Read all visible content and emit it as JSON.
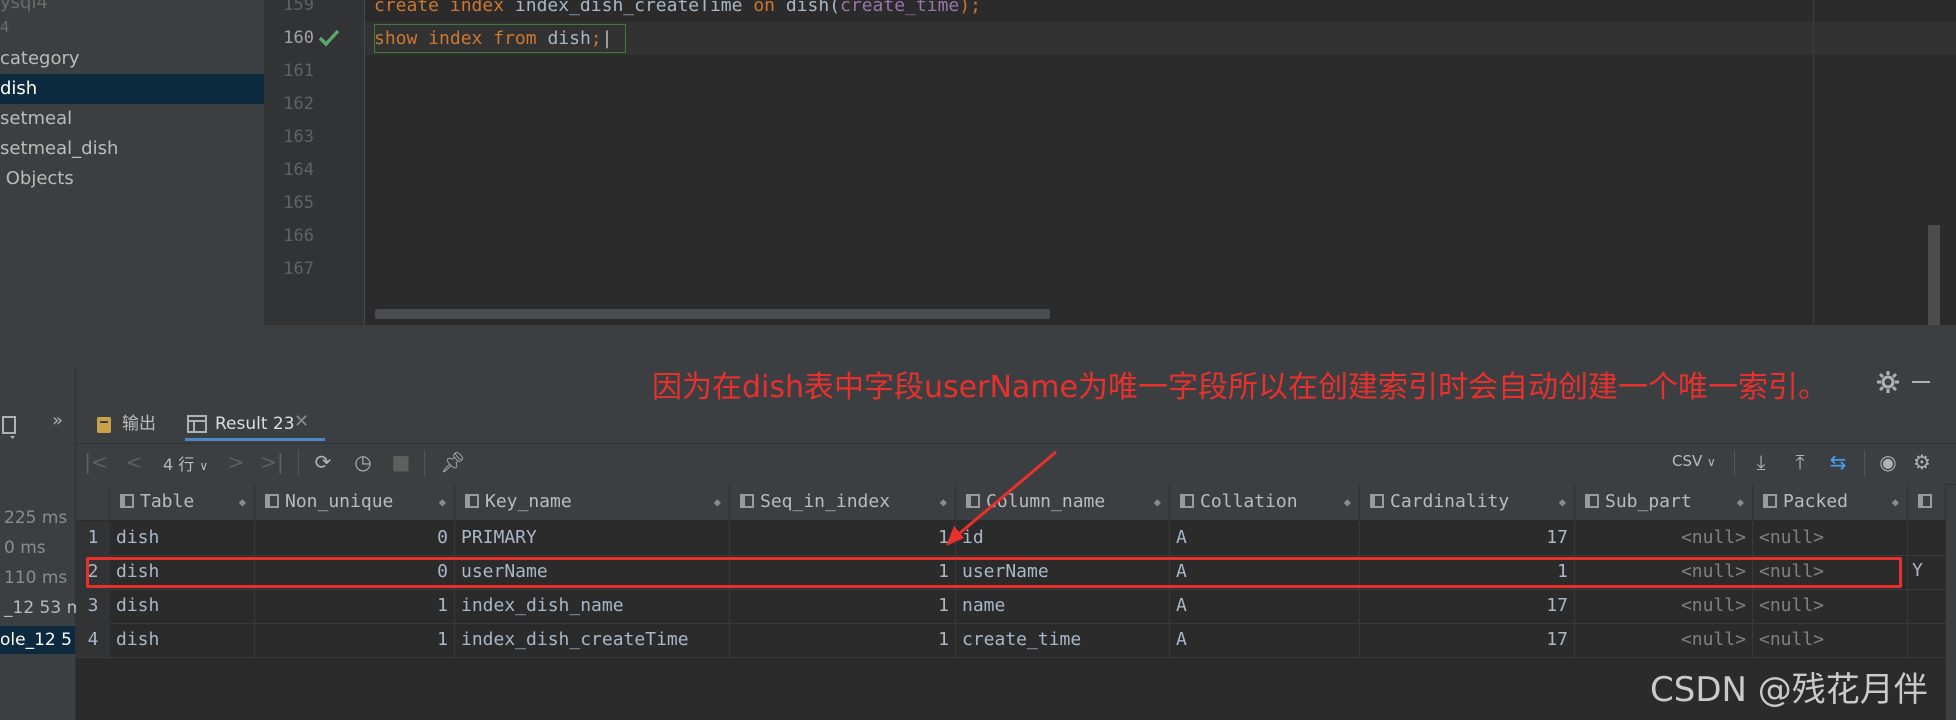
{
  "sidebar": {
    "items": [
      {
        "label": "ysql4"
      },
      {
        "label": "4"
      },
      {
        "label": "category"
      },
      {
        "label": "dish"
      },
      {
        "label": "setmeal"
      },
      {
        "label": "setmeal_dish"
      },
      {
        "label": "Objects"
      }
    ]
  },
  "editor": {
    "line_numbers": [
      "159",
      "160",
      "161",
      "162",
      "163",
      "164",
      "165",
      "166",
      "167"
    ],
    "line159": {
      "kw1": "create",
      "kw2": "index",
      "name": "index_dish_createTime",
      "kw3": "on",
      "table": "dish(",
      "field": "create_time",
      "end": ");"
    },
    "line160": {
      "kw1": "show",
      "kw2": "index",
      "kw3": "from",
      "table": "dish",
      "end": ";"
    }
  },
  "annotation": "因为在dish表中字段userName为唯一字段所以在创建索引时会自动创建一个唯一索引。",
  "left_rail": {
    "chevron": "»",
    "timings": [
      "225 ms",
      "0 ms",
      "110 ms",
      "_12  53 m",
      "ole_12  5"
    ]
  },
  "tabs": [
    {
      "label": "输出"
    },
    {
      "label": "Result 23"
    }
  ],
  "toolbar": {
    "row_count": "4 行",
    "export_format": "CSV"
  },
  "table": {
    "columns": [
      "Table",
      "Non_unique",
      "Key_name",
      "Seq_in_index",
      "Column_name",
      "Collation",
      "Cardinality",
      "Sub_part",
      "Packed"
    ],
    "rows": [
      {
        "n": "1",
        "Table": "dish",
        "Non_unique": "0",
        "Key_name": "PRIMARY",
        "Seq_in_index": "1",
        "Column_name": "id",
        "Collation": "A",
        "Cardinality": "17",
        "Sub_part": "<null>",
        "Packed": "<null>"
      },
      {
        "n": "2",
        "Table": "dish",
        "Non_unique": "0",
        "Key_name": "userName",
        "Seq_in_index": "1",
        "Column_name": "userName",
        "Collation": "A",
        "Cardinality": "1",
        "Sub_part": "<null>",
        "Packed": "<null>"
      },
      {
        "n": "3",
        "Table": "dish",
        "Non_unique": "1",
        "Key_name": "index_dish_name",
        "Seq_in_index": "1",
        "Column_name": "name",
        "Collation": "A",
        "Cardinality": "17",
        "Sub_part": "<null>",
        "Packed": "<null>"
      },
      {
        "n": "4",
        "Table": "dish",
        "Non_unique": "1",
        "Key_name": "index_dish_createTime",
        "Seq_in_index": "1",
        "Column_name": "create_time",
        "Collation": "A",
        "Cardinality": "17",
        "Sub_part": "<null>",
        "Packed": "<null>"
      }
    ],
    "overflow_cell": "Y"
  },
  "watermark": "CSDN @残花月伴",
  "colors": {
    "accent_red": "#e8302c",
    "keyword": "#cc7832",
    "field": "#9876aa",
    "selection": "#0d293e"
  }
}
